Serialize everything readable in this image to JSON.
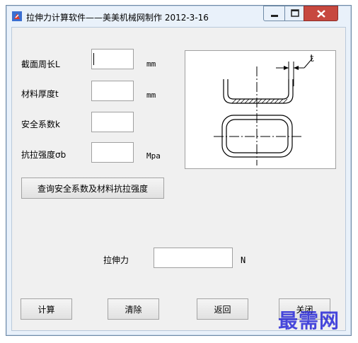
{
  "window": {
    "title": "拉伸力计算软件——美美机械网制作  2012-3-16",
    "accent_close": "#c7483f"
  },
  "form": {
    "perimeter_label": "截面周长L",
    "perimeter_unit": "mm",
    "perimeter_value": "",
    "thickness_label": "材料厚度t",
    "thickness_unit": "mm",
    "thickness_value": "",
    "safety_label": "安全系数k",
    "safety_value": "",
    "strength_label": "抗拉强度σb",
    "strength_unit": "Mpa",
    "strength_value": ""
  },
  "lookup_button": "查询安全系数及材料抗拉强度",
  "diagram": {
    "dimension_label": "t"
  },
  "result": {
    "label": "拉伸力",
    "value": "",
    "unit": "N"
  },
  "buttons": {
    "calculate": "计算",
    "clear": "清除",
    "back": "返回",
    "close": "关闭"
  },
  "watermark": "最需网",
  "icons": {
    "app": "app-icon",
    "minimize": "minimize-icon",
    "maximize": "maximize-icon",
    "close": "close-icon"
  }
}
